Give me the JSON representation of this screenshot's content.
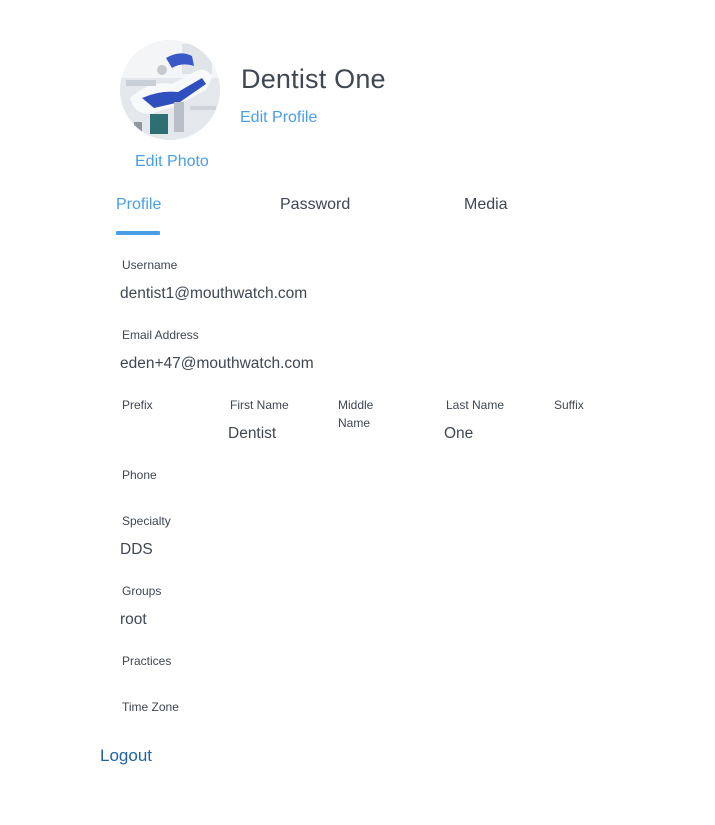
{
  "header": {
    "name": "Dentist One",
    "edit_profile_label": "Edit Profile",
    "edit_photo_label": "Edit Photo"
  },
  "tabs": [
    {
      "label": "Profile",
      "active": true
    },
    {
      "label": "Password",
      "active": false
    },
    {
      "label": "Media",
      "active": false
    }
  ],
  "fields": {
    "username": {
      "label": "Username",
      "value": "dentist1@mouthwatch.com"
    },
    "email": {
      "label": "Email Address",
      "value": "eden+47@mouthwatch.com"
    },
    "prefix": {
      "label": "Prefix",
      "value": ""
    },
    "first_name": {
      "label": "First Name",
      "value": "Dentist"
    },
    "middle_name": {
      "label": "Middle Name",
      "value": ""
    },
    "last_name": {
      "label": "Last Name",
      "value": "One"
    },
    "suffix": {
      "label": "Suffix",
      "value": ""
    },
    "phone": {
      "label": "Phone",
      "value": ""
    },
    "specialty": {
      "label": "Specialty",
      "value": "DDS"
    },
    "groups": {
      "label": "Groups",
      "value": "root"
    },
    "practices": {
      "label": "Practices",
      "value": ""
    },
    "time_zone": {
      "label": "Time Zone",
      "value": ""
    }
  },
  "footer": {
    "logout_label": "Logout"
  },
  "colors": {
    "accent": "#4a9ee8",
    "text": "#3f4752",
    "logout": "#1f63a6"
  }
}
